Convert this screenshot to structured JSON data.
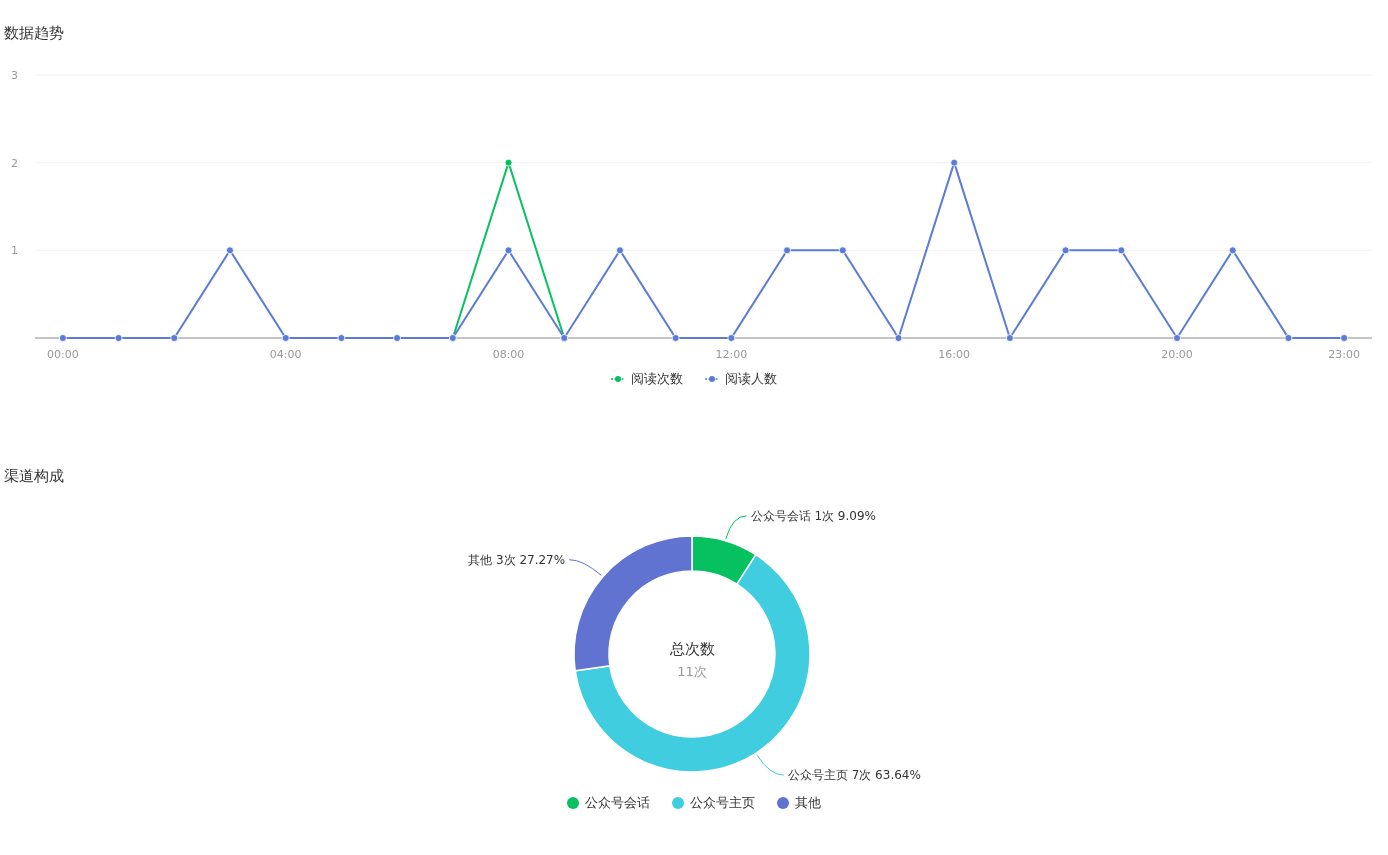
{
  "trend": {
    "title": "数据趋势",
    "chart_data": {
      "type": "line",
      "x": [
        0,
        1,
        2,
        3,
        4,
        5,
        6,
        7,
        8,
        9,
        10,
        11,
        12,
        13,
        14,
        15,
        16,
        17,
        18,
        19,
        20,
        21,
        22,
        23
      ],
      "xticks": [
        {
          "value": 0,
          "label": "00:00"
        },
        {
          "value": 4,
          "label": "04:00"
        },
        {
          "value": 8,
          "label": "08:00"
        },
        {
          "value": 12,
          "label": "12:00"
        },
        {
          "value": 16,
          "label": "16:00"
        },
        {
          "value": 20,
          "label": "20:00"
        },
        {
          "value": 23,
          "label": "23:00"
        }
      ],
      "xlim": [
        -0.5,
        23.5
      ],
      "ylim": [
        0,
        3
      ],
      "yticks": [
        1,
        2,
        3
      ],
      "series": [
        {
          "name": "阅读次数",
          "color": "#07c160",
          "marker": "circle",
          "values": [
            null,
            null,
            null,
            null,
            null,
            null,
            null,
            0,
            2,
            0,
            null,
            null,
            null,
            null,
            null,
            null,
            null,
            null,
            null,
            null,
            null,
            null,
            null,
            null
          ]
        },
        {
          "name": "阅读人数",
          "color": "#5b7bd5",
          "marker": "circle",
          "values": [
            0,
            0,
            0,
            1,
            0,
            0,
            0,
            0,
            1,
            0,
            1,
            0,
            0,
            1,
            1,
            0,
            2,
            0,
            1,
            1,
            0,
            1,
            0,
            0
          ]
        }
      ]
    }
  },
  "channels": {
    "title": "渠道构成",
    "center_title": "总次数",
    "center_value": "11次",
    "chart_data": {
      "type": "donut",
      "categories": [
        "公众号会话",
        "公众号主页",
        "其他"
      ],
      "values": [
        1,
        7,
        3
      ],
      "value_labels": [
        "公众号会话 1次 9.09%",
        "公众号主页 7次 63.64%",
        "其他 3次 27.27%"
      ]
    },
    "legend": [
      {
        "color": "#07c160"
      },
      {
        "color": "#40cde0"
      },
      {
        "color": "#6173d1"
      }
    ]
  }
}
